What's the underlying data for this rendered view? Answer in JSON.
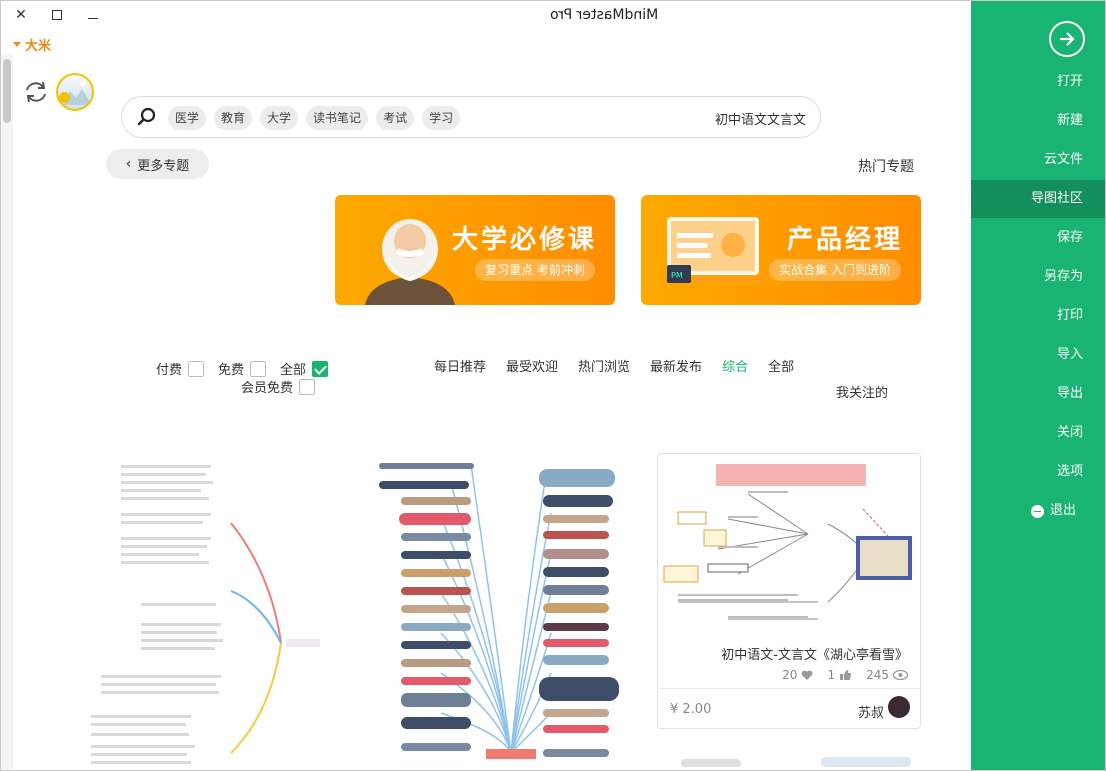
{
  "app": {
    "title": "MindMaster Pro"
  },
  "window": {
    "close": "✕",
    "maximize": "□",
    "minimize": "—"
  },
  "user": {
    "name": "大米"
  },
  "search": {
    "query": "初中语文文言文",
    "tags": [
      "学习",
      "考试",
      "读书笔记",
      "大学",
      "教育",
      "医学"
    ]
  },
  "section": {
    "title": "热门专题",
    "more": "更多专题"
  },
  "banners": [
    {
      "title": "产品经理",
      "subtitle": "实战合集 入门到进阶"
    },
    {
      "title": "大学必修课",
      "subtitle": "复习重点 考前冲刺"
    }
  ],
  "tabs": {
    "items": [
      "全部",
      "综合",
      "最新发布",
      "热门浏览",
      "最受欢迎",
      "每日推荐"
    ],
    "active": "综合",
    "second_row": "我关注的"
  },
  "filters": {
    "all": "全部",
    "free": "免费",
    "paid": "付费",
    "member_free": "会员免费"
  },
  "cards": [
    {
      "caption": "初中语文-文言文《湖心亭看雪》",
      "views": "245",
      "likes": "1",
      "favorites": "20",
      "author": "苏叔",
      "price": "¥ 2.00"
    }
  ],
  "sidebar": {
    "items": [
      "打开",
      "新建",
      "云文件",
      "导图社区",
      "保存",
      "另存为",
      "打印",
      "导入",
      "导出",
      "关闭",
      "选项",
      "退出"
    ],
    "selected": "导图社区"
  },
  "colors": {
    "brand_green": "#19b372",
    "selected_green": "#138f5b",
    "banner_orange": "#ff8d00",
    "user_orange": "#e98a12"
  }
}
